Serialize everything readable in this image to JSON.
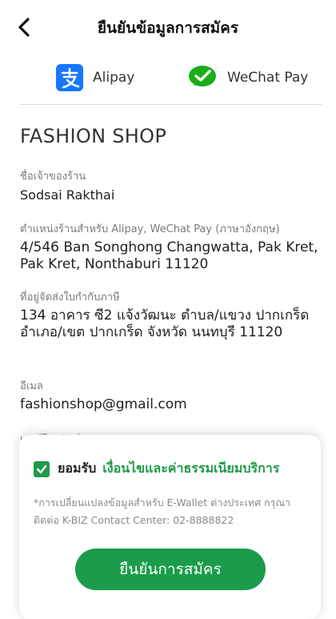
{
  "header": {
    "title": "ยืนยันข้อมูลการสมัคร"
  },
  "wallets": {
    "alipay": {
      "name": "Alipay",
      "icon": "alipay-icon",
      "color": "#1677ff"
    },
    "wechat": {
      "name": "WeChat Pay",
      "icon": "wechat-pay-icon",
      "color": "#1aad19"
    }
  },
  "shop": {
    "name": "FASHION SHOP",
    "fields": [
      {
        "label": "ชื่อเจ้าของร้าน",
        "value": "Sodsai Rakthai"
      },
      {
        "label": "ตำแหน่งร้านสำหรับ Alipay, WeChat Pay (ภาษาอังกฤษ)",
        "value": "4/546 Ban Songhong Changwatta, Pak Kret, Pak Kret, Nonthaburi 11120"
      },
      {
        "label": "ที่อยู่จัดส่งใบกำกับภาษี",
        "value": "134 อาคาร ซี2  แจ้งวัฒนะ ตำบล/แขวง ปากเกร็ด อำเภอ/เขต ปากเกร็ด จังหวัด นนทบุรี 11120"
      },
      {
        "label": "อีเมล",
        "value": "fashionshop@gmail.com"
      }
    ],
    "partial_label": "เบอร์โทรศัพท์"
  },
  "agreement": {
    "accept_label": "ยอมรับ",
    "terms_link": "เงื่อนไขและค่าธรรมเนียมบริการ",
    "note": "*การเปลี่ยนแปลงข้อมูลสำหรับ E-Wallet ต่างประเทศ กรุณาติดต่อ K-BIZ Contact Center: 02-8888822",
    "confirm_label": "ยืนยันการสมัคร"
  },
  "colors": {
    "accent": "#1a9c4b",
    "text": "#222222",
    "muted": "#7a7a7a"
  }
}
